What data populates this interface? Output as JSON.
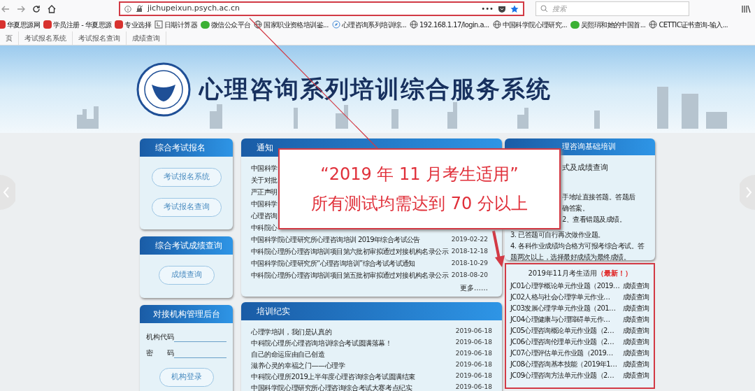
{
  "browser": {
    "url": "jichupeixun.psych.ac.cn",
    "more": "•••",
    "search": {
      "placeholder": "搜索"
    }
  },
  "bookmarks": [
    {
      "label": "华夏思源网",
      "kind": "brand"
    },
    {
      "label": "学员注册 - 华夏思源",
      "kind": "brand"
    },
    {
      "label": "专业选择",
      "kind": "brand"
    },
    {
      "label": "日期计算器",
      "kind": "calendar"
    },
    {
      "label": "微信公众平台",
      "kind": "chat"
    },
    {
      "label": "国家职业资格培训鉴...",
      "kind": "globe"
    },
    {
      "label": "心理咨询系列培训综...",
      "kind": "compass"
    },
    {
      "label": "192.168.1.17/login.a...",
      "kind": "globe"
    },
    {
      "label": "中国科学院心理研究...",
      "kind": "globe"
    },
    {
      "label": "吴熙琄和她的中国首...",
      "kind": "chat"
    },
    {
      "label": "CETTIC证书查询-输入...",
      "kind": "globe"
    }
  ],
  "tabs": [
    {
      "label": "页",
      "selected": false
    },
    {
      "label": "考试报名系统",
      "selected": false
    },
    {
      "label": "考试报名查询",
      "selected": false
    },
    {
      "label": "成绩查询",
      "selected": false
    }
  ],
  "banner": {
    "title": "心理咨询系列培训综合服务系统"
  },
  "register": {
    "title": "综合考试报名",
    "buttons": [
      "考试报名系统",
      "考试报名查询"
    ]
  },
  "scores": {
    "title": "综合考试成绩查询",
    "buttons": [
      "成绩查询"
    ]
  },
  "org": {
    "title": "对接机构管理后台",
    "fields": [
      {
        "label": "机构代码"
      },
      {
        "label": "密　　码"
      }
    ],
    "button": "机构登录"
  },
  "notices": {
    "title": "通知",
    "more": "更多……",
    "items": [
      {
        "title": "中国科学"
      },
      {
        "title": "关于对批"
      },
      {
        "title": "严正声明"
      },
      {
        "title": "中国科学"
      },
      {
        "title": "心理咨询"
      },
      {
        "title": "中科院心"
      },
      {
        "title": "中国科学院心理研究所心理咨询培训 2019年综合考试公告",
        "date": "2019-02-22"
      },
      {
        "title": "中科院心理所心理咨询培训项目第六批初审拟通过对接机构名录公示",
        "date": "2018-12-18"
      },
      {
        "title": "中国科学院心理研究所“心理咨询培训”综合考试考试通知",
        "date": "2018-10-29"
      },
      {
        "title": "中科院心理所心理咨询培训项目第五批初审拟通过对接机构名录公示",
        "date": "2018-08-20"
      }
    ]
  },
  "training": {
    "title": "培训纪实",
    "items": [
      {
        "title": "心理学培训，我们是认真的",
        "date": "2019-06-18"
      },
      {
        "title": "中科院心理所心理咨询培训综合考试圆满落幕！",
        "date": "2019-06-18"
      },
      {
        "title": "自己的命运应由自己创造",
        "date": "2019-06-18"
      },
      {
        "title": "滋养心灵的幸福之门——心理学",
        "date": "2019-06-18"
      },
      {
        "title": "中科院心理所2019上半年度心理咨询综合考试圆满结束",
        "date": "2019-06-18"
      },
      {
        "title": "中国科学院心理研究所心理咨询综合考试大赛考点纪实",
        "date": "2019-06-18"
      }
    ]
  },
  "guide": {
    "title": "理咨询基础培训",
    "lines": [
      {
        "text": "式及成绩查询",
        "kind": "heading"
      },
      {
        "text": "手地址直接答题。答题后",
        "kind": "partial"
      },
      {
        "text": "确答案。",
        "kind": "partial"
      },
      {
        "text": "2、查看错题及成绩。",
        "kind": "partial"
      },
      {
        "text": "3. 已答题可自行再次做作业题。",
        "kind": "full"
      },
      {
        "text": "4. 各科作业成绩均合格方可报考综合考试。答题两次以上，选择最好成绩为最终成绩。",
        "kind": "full"
      }
    ]
  },
  "exams": {
    "title": "2019年11月考生适用",
    "badge": "（最新！）",
    "items": [
      {
        "name": "JC01心理学概论单元作业题（2019…",
        "action": "成绩查询"
      },
      {
        "name": "JC02人格与社会心理学单元作业…",
        "action": "成绩查询"
      },
      {
        "name": "JC03发展心理学单元作业题（201…",
        "action": "成绩查询"
      },
      {
        "name": "JC04心理健康与心理障碍单元作…",
        "action": "成绩查询"
      },
      {
        "name": "JC05心理咨询概论单元作业题（2…",
        "action": "成绩查询"
      },
      {
        "name": "JC06心理咨询伦理单元作业题（2…",
        "action": "成绩查询"
      },
      {
        "name": "JC07心理评估单元作业题（2019…",
        "action": "成绩查询"
      },
      {
        "name": "JC08心理咨询基本技能（2019年1…",
        "action": "成绩查询"
      },
      {
        "name": "JC09心理咨询方法单元作业题（2…",
        "action": "成绩查询"
      }
    ]
  },
  "callout": {
    "lines": [
      "“2019 年 11 月考生适用”",
      "所有测试均需达到 70 分以上"
    ]
  }
}
